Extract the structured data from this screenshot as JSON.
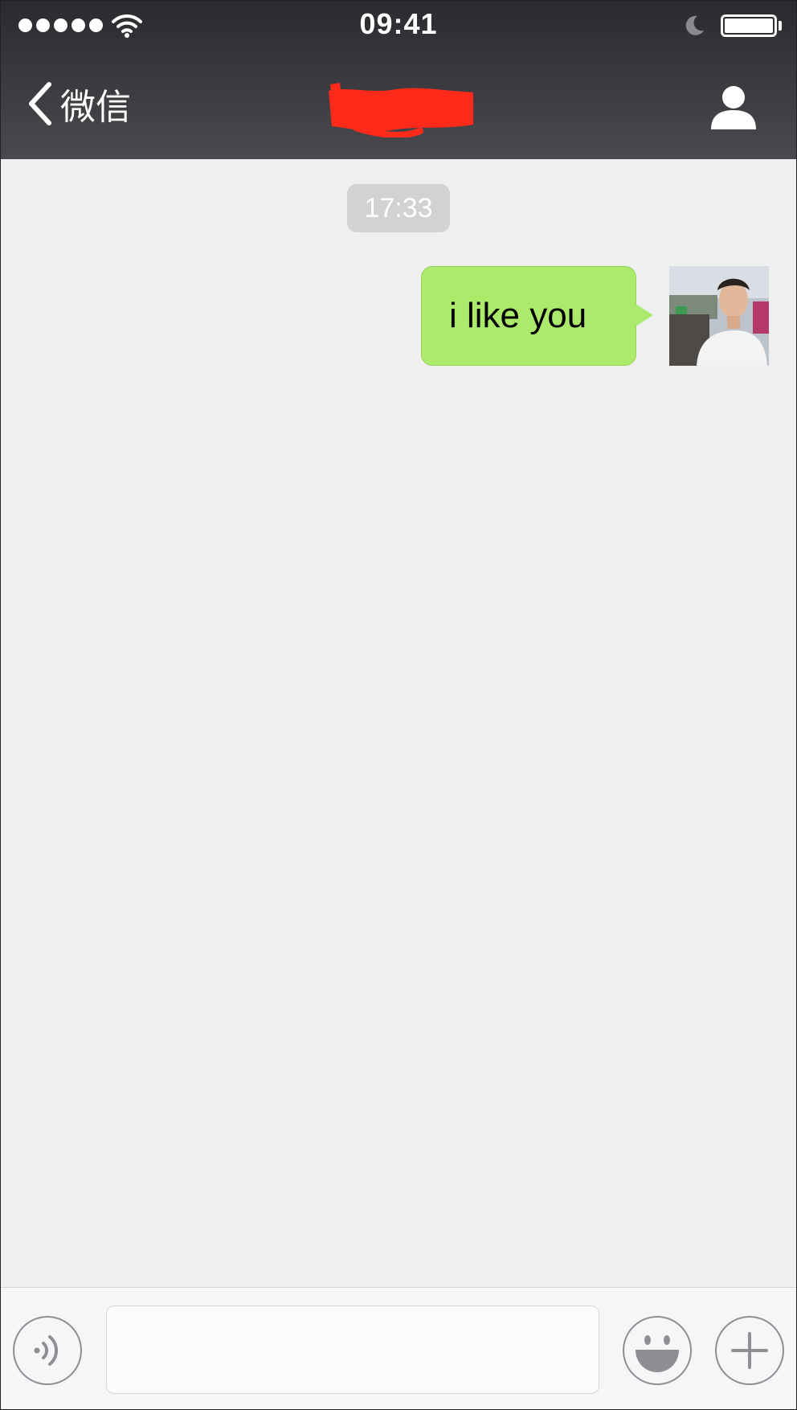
{
  "status_bar": {
    "time": "09:41",
    "signal_icon": "signal-dots-icon",
    "wifi_icon": "wifi-icon",
    "moon_icon": "do-not-disturb-moon-icon",
    "battery_icon": "battery-icon",
    "battery_level": 1.0
  },
  "nav_bar": {
    "back_label": "微信",
    "back_icon": "chevron-left-icon",
    "title_redacted": true,
    "redaction_color": "#ff2a1a",
    "contact_icon": "person-icon"
  },
  "chat": {
    "timestamp": "17:33",
    "messages": [
      {
        "sender": "me",
        "text": "i like you",
        "bubble_color": "#acea6c"
      }
    ]
  },
  "input_bar": {
    "voice_icon": "voice-input-icon",
    "input_value": "",
    "emoji_icon": "smiley-icon",
    "more_icon": "plus-icon"
  },
  "colors": {
    "header_bg": "#3a3a3e",
    "chat_bg": "#efefef",
    "timestamp_bg": "#d2d2d2",
    "input_bar_bg": "#f6f6f8"
  }
}
